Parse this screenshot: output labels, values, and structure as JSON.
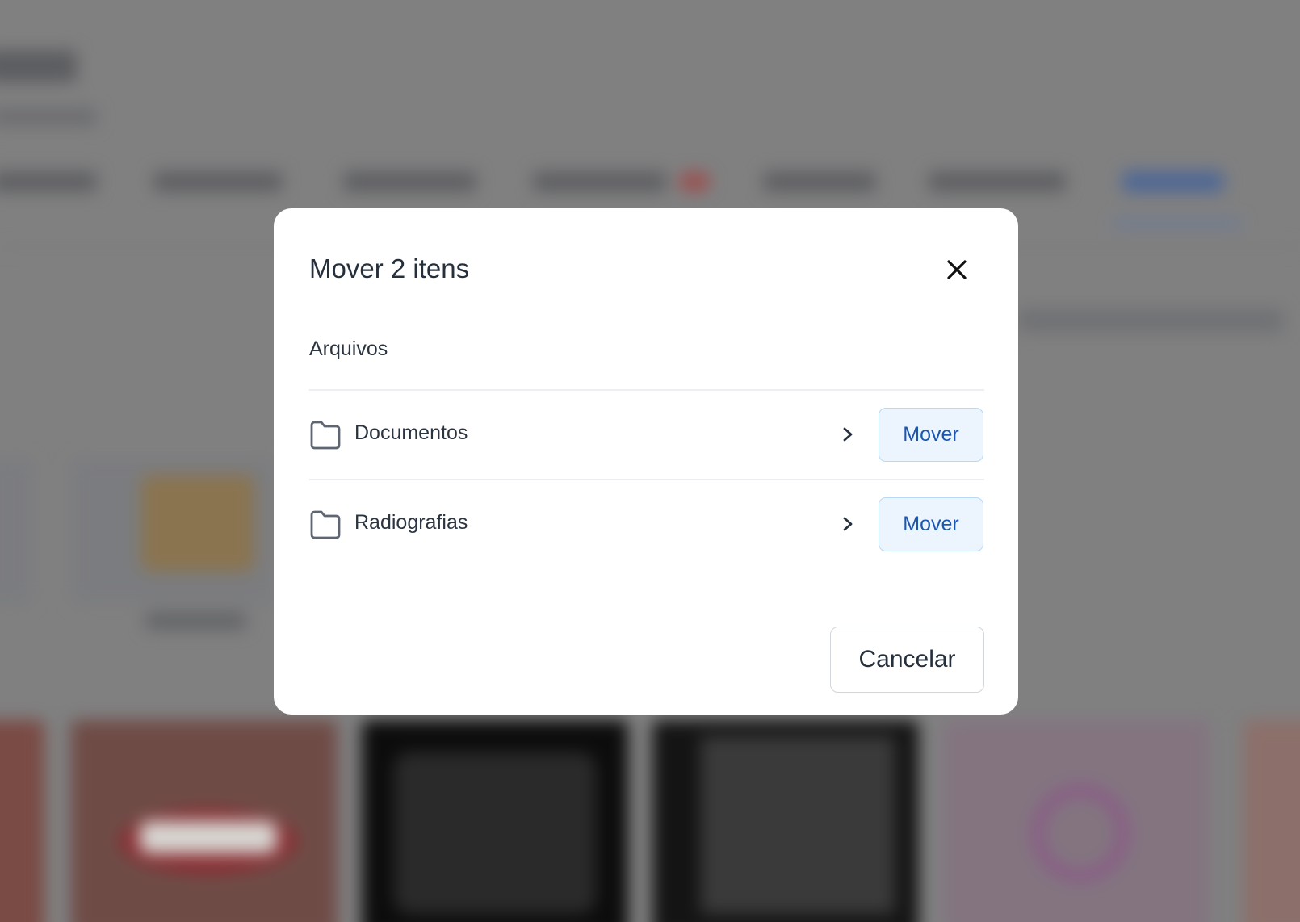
{
  "dialog": {
    "title": "Mover 2 itens",
    "close_icon": "close-icon",
    "breadcrumb": "Arquivos",
    "folders": [
      {
        "name": "Documentos",
        "icon": "folder-icon",
        "action_label": "Mover"
      },
      {
        "name": "Radiografias",
        "icon": "folder-icon",
        "action_label": "Mover"
      }
    ],
    "cancel_label": "Cancelar"
  },
  "colors": {
    "overlay": "#808081",
    "title_text": "#26303d",
    "move_button_bg": "#ecf5fe",
    "move_button_text": "#1b57b0",
    "move_button_border": "#b7d8f6"
  }
}
